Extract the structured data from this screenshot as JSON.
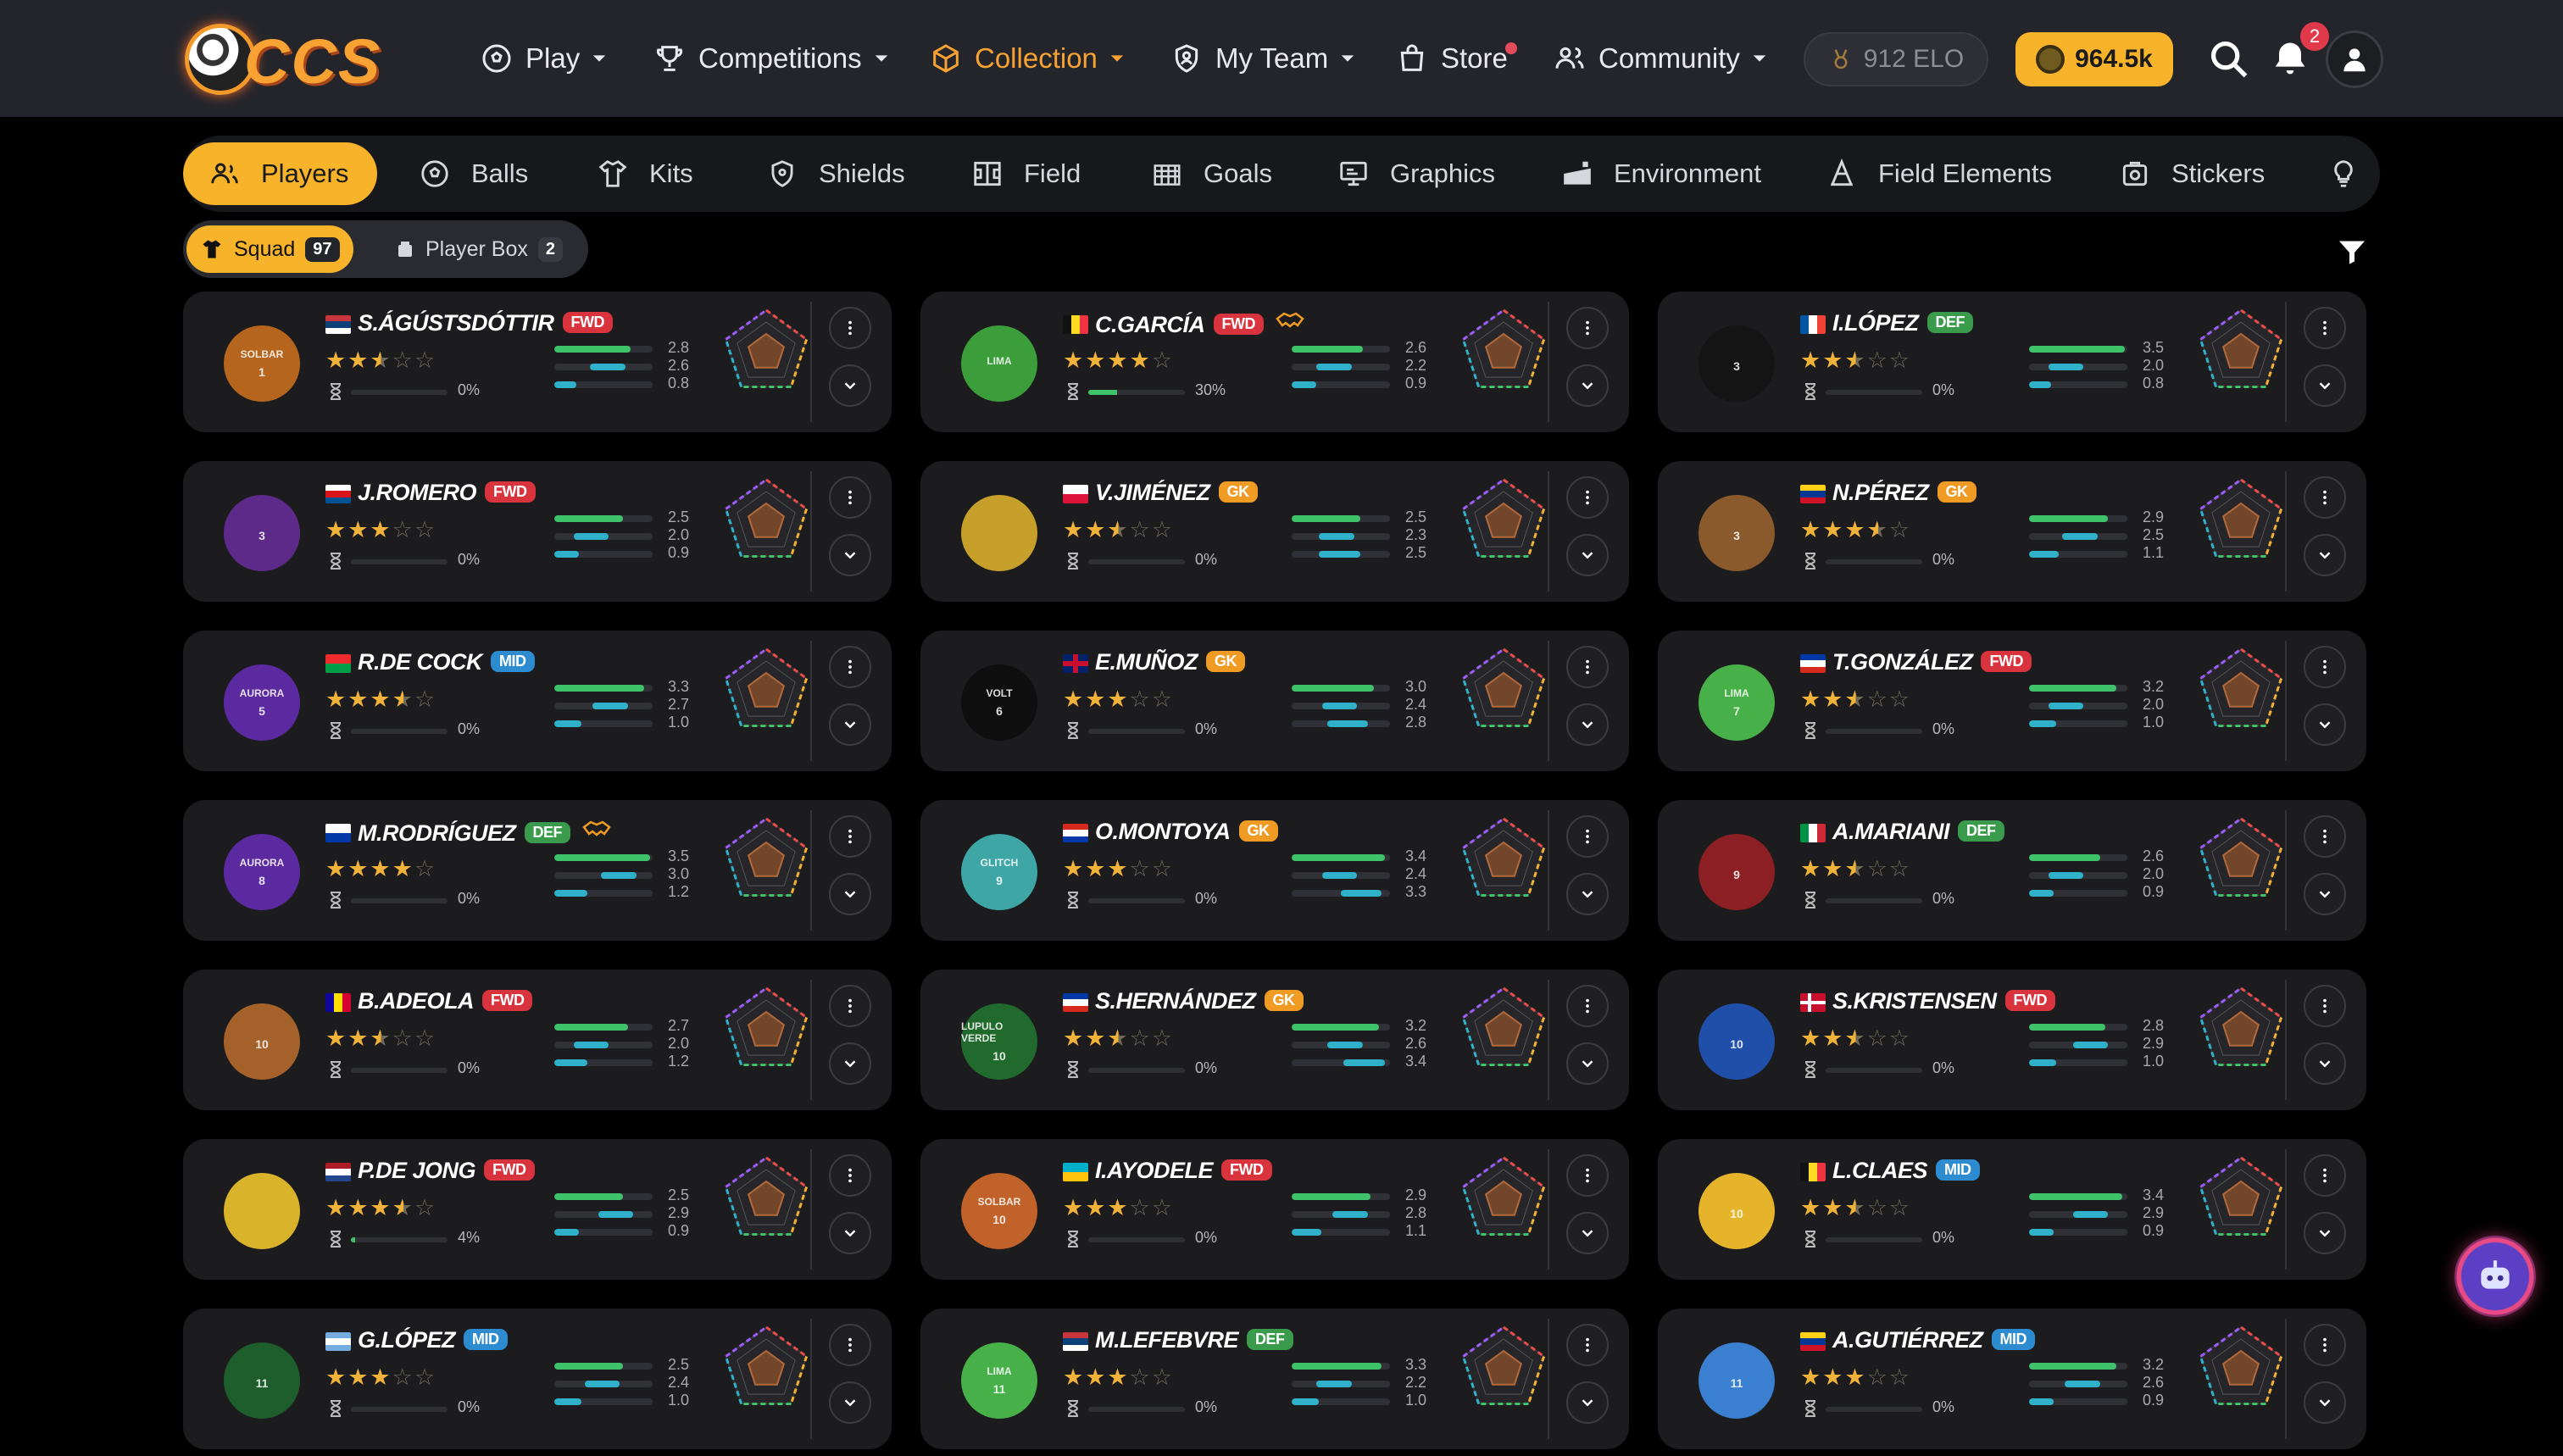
{
  "logo_text": "CCS",
  "nav": [
    {
      "label": "Play",
      "icon": "soccer-ball-icon",
      "caret": true
    },
    {
      "label": "Competitions",
      "icon": "trophy-icon",
      "caret": true
    },
    {
      "label": "Collection",
      "icon": "cube-icon",
      "caret": true,
      "active": true
    },
    {
      "label": "My Team",
      "icon": "shield-user-icon",
      "caret": true
    },
    {
      "label": "Store",
      "icon": "store-icon",
      "caret": false,
      "dot": true
    },
    {
      "label": "Community",
      "icon": "people-icon",
      "caret": true
    }
  ],
  "header": {
    "elo": "912 ELO",
    "coins": "964.5k",
    "notifications": "2"
  },
  "categories": [
    "Players",
    "Balls",
    "Kits",
    "Shields",
    "Field",
    "Goals",
    "Graphics",
    "Environment",
    "Field Elements",
    "Stickers"
  ],
  "subtabs": [
    {
      "label": "Squad",
      "count": "97"
    },
    {
      "label": "Player Box",
      "count": "2"
    }
  ],
  "colors": {
    "accent": "#f7b32a",
    "collection_active": "#f7a233",
    "card_bg": "#1c1c1e",
    "fwd": "#d9343e",
    "gk": "#ef9b24",
    "def": "#3a9b4c",
    "mid": "#2c8ccf"
  },
  "players": [
    {
      "name": "S.ÁGÚSTSDÓTTIR",
      "pos": "FWD",
      "flag": "rs",
      "rating": 2.5,
      "training": "0%",
      "progress": 0,
      "stats": [
        "2.8",
        "2.6",
        "0.8"
      ],
      "bottle": {
        "color": "#b5651d",
        "text": "SOLBAR",
        "num": "1"
      }
    },
    {
      "name": "C.GARCÍA",
      "pos": "FWD",
      "flag": "be",
      "rating": 4,
      "training": "30%",
      "progress": 0.3,
      "stats": [
        "2.6",
        "2.2",
        "0.9"
      ],
      "bottle": {
        "color": "#3b9e3a",
        "text": "LIMA",
        "num": ""
      },
      "handshake": true
    },
    {
      "name": "I.LÓPEZ",
      "pos": "DEF",
      "flag": "fr",
      "rating": 2.5,
      "training": "0%",
      "progress": 0,
      "stats": [
        "3.5",
        "2.0",
        "0.8"
      ],
      "bottle": {
        "color": "#141414",
        "text": "",
        "num": "3"
      }
    },
    {
      "name": "J.ROMERO",
      "pos": "FWD",
      "flag": "pa",
      "rating": 3,
      "training": "0%",
      "progress": 0,
      "stats": [
        "2.5",
        "2.0",
        "0.9"
      ],
      "bottle": {
        "color": "#5e2a8a",
        "text": "",
        "num": "3"
      }
    },
    {
      "name": "V.JIMÉNEZ",
      "pos": "GK",
      "flag": "pl",
      "rating": 2.5,
      "training": "0%",
      "progress": 0,
      "stats": [
        "2.5",
        "2.3",
        "2.5"
      ],
      "bottle": {
        "color": "#c6a02a",
        "text": "",
        "num": ""
      }
    },
    {
      "name": "N.PÉREZ",
      "pos": "GK",
      "flag": "co",
      "rating": 3.5,
      "training": "0%",
      "progress": 0,
      "stats": [
        "2.9",
        "2.5",
        "1.1"
      ],
      "bottle": {
        "color": "#8a5a2c",
        "text": "",
        "num": "3"
      }
    },
    {
      "name": "R.DE COCK",
      "pos": "MID",
      "flag": "bf",
      "rating": 3.5,
      "training": "0%",
      "progress": 0,
      "stats": [
        "3.3",
        "2.7",
        "1.0"
      ],
      "bottle": {
        "color": "#5b2aa0",
        "text": "AURORA",
        "num": "5"
      }
    },
    {
      "name": "E.MUÑOZ",
      "pos": "GK",
      "flag": "gb",
      "rating": 3,
      "training": "0%",
      "progress": 0,
      "stats": [
        "3.0",
        "2.4",
        "2.8"
      ],
      "bottle": {
        "color": "#0e0e0e",
        "text": "VOLT",
        "num": "6"
      }
    },
    {
      "name": "T.GONZÁLEZ",
      "pos": "FWD",
      "flag": "cl",
      "rating": 2.5,
      "training": "0%",
      "progress": 0,
      "stats": [
        "3.2",
        "2.0",
        "1.0"
      ],
      "bottle": {
        "color": "#48b049",
        "text": "LIMA",
        "num": "7"
      }
    },
    {
      "name": "M.RODRÍGUEZ",
      "pos": "DEF",
      "flag": "uy",
      "rating": 4,
      "training": "0%",
      "progress": 0,
      "stats": [
        "3.5",
        "3.0",
        "1.2"
      ],
      "bottle": {
        "color": "#5b2aa0",
        "text": "AURORA",
        "num": "8"
      },
      "handshake": true
    },
    {
      "name": "O.MONTOYA",
      "pos": "GK",
      "flag": "py",
      "rating": 3,
      "training": "0%",
      "progress": 0,
      "stats": [
        "3.4",
        "2.4",
        "3.3"
      ],
      "bottle": {
        "color": "#3fa6a6",
        "text": "GLITCH",
        "num": "9"
      }
    },
    {
      "name": "A.MARIANI",
      "pos": "DEF",
      "flag": "it",
      "rating": 2.5,
      "training": "0%",
      "progress": 0,
      "stats": [
        "2.6",
        "2.0",
        "0.9"
      ],
      "bottle": {
        "color": "#8c1f24",
        "text": "",
        "num": "9"
      }
    },
    {
      "name": "B.ADEOLA",
      "pos": "FWD",
      "flag": "ad",
      "rating": 2.5,
      "training": "0%",
      "progress": 0,
      "stats": [
        "2.7",
        "2.0",
        "1.2"
      ],
      "bottle": {
        "color": "#a4622a",
        "text": "",
        "num": "10"
      }
    },
    {
      "name": "S.HERNÁNDEZ",
      "pos": "GK",
      "flag": "cl",
      "rating": 2.5,
      "training": "0%",
      "progress": 0,
      "stats": [
        "3.2",
        "2.6",
        "3.4"
      ],
      "bottle": {
        "color": "#1f6a2c",
        "text": "LUPULO VERDE",
        "num": "10"
      }
    },
    {
      "name": "S.KRISTENSEN",
      "pos": "FWD",
      "flag": "dk",
      "rating": 2.5,
      "training": "0%",
      "progress": 0,
      "stats": [
        "2.8",
        "2.9",
        "1.0"
      ],
      "bottle": {
        "color": "#1f4fa8",
        "text": "",
        "num": "10"
      }
    },
    {
      "name": "P.DE JONG",
      "pos": "FWD",
      "flag": "nl",
      "rating": 3.5,
      "training": "4%",
      "progress": 0.04,
      "stats": [
        "2.5",
        "2.9",
        "0.9"
      ],
      "bottle": {
        "color": "#d9b42a",
        "text": "",
        "num": ""
      }
    },
    {
      "name": "I.AYODELE",
      "pos": "FWD",
      "flag": "kz",
      "rating": 3,
      "training": "0%",
      "progress": 0,
      "stats": [
        "2.9",
        "2.8",
        "1.1"
      ],
      "bottle": {
        "color": "#c0622a",
        "text": "SOLBAR",
        "num": "10"
      }
    },
    {
      "name": "L.CLAES",
      "pos": "MID",
      "flag": "be",
      "rating": 2.5,
      "training": "0%",
      "progress": 0,
      "stats": [
        "3.4",
        "2.9",
        "0.9"
      ],
      "bottle": {
        "color": "#e6b42a",
        "text": "",
        "num": "10"
      }
    },
    {
      "name": "G.LÓPEZ",
      "pos": "MID",
      "flag": "ar",
      "rating": 3,
      "training": "0%",
      "progress": 0,
      "stats": [
        "2.5",
        "2.4",
        "1.0"
      ],
      "bottle": {
        "color": "#1d5e2c",
        "text": "",
        "num": "11"
      }
    },
    {
      "name": "M.LEFEBVRE",
      "pos": "DEF",
      "flag": "rs",
      "rating": 3,
      "training": "0%",
      "progress": 0,
      "stats": [
        "3.3",
        "2.2",
        "1.0"
      ],
      "bottle": {
        "color": "#48b049",
        "text": "LIMA",
        "num": "11"
      }
    },
    {
      "name": "A.GUTIÉRREZ",
      "pos": "MID",
      "flag": "co",
      "rating": 3,
      "training": "0%",
      "progress": 0,
      "stats": [
        "3.2",
        "2.6",
        "0.9"
      ],
      "bottle": {
        "color": "#3a7fd0",
        "text": "",
        "num": "11"
      }
    }
  ]
}
